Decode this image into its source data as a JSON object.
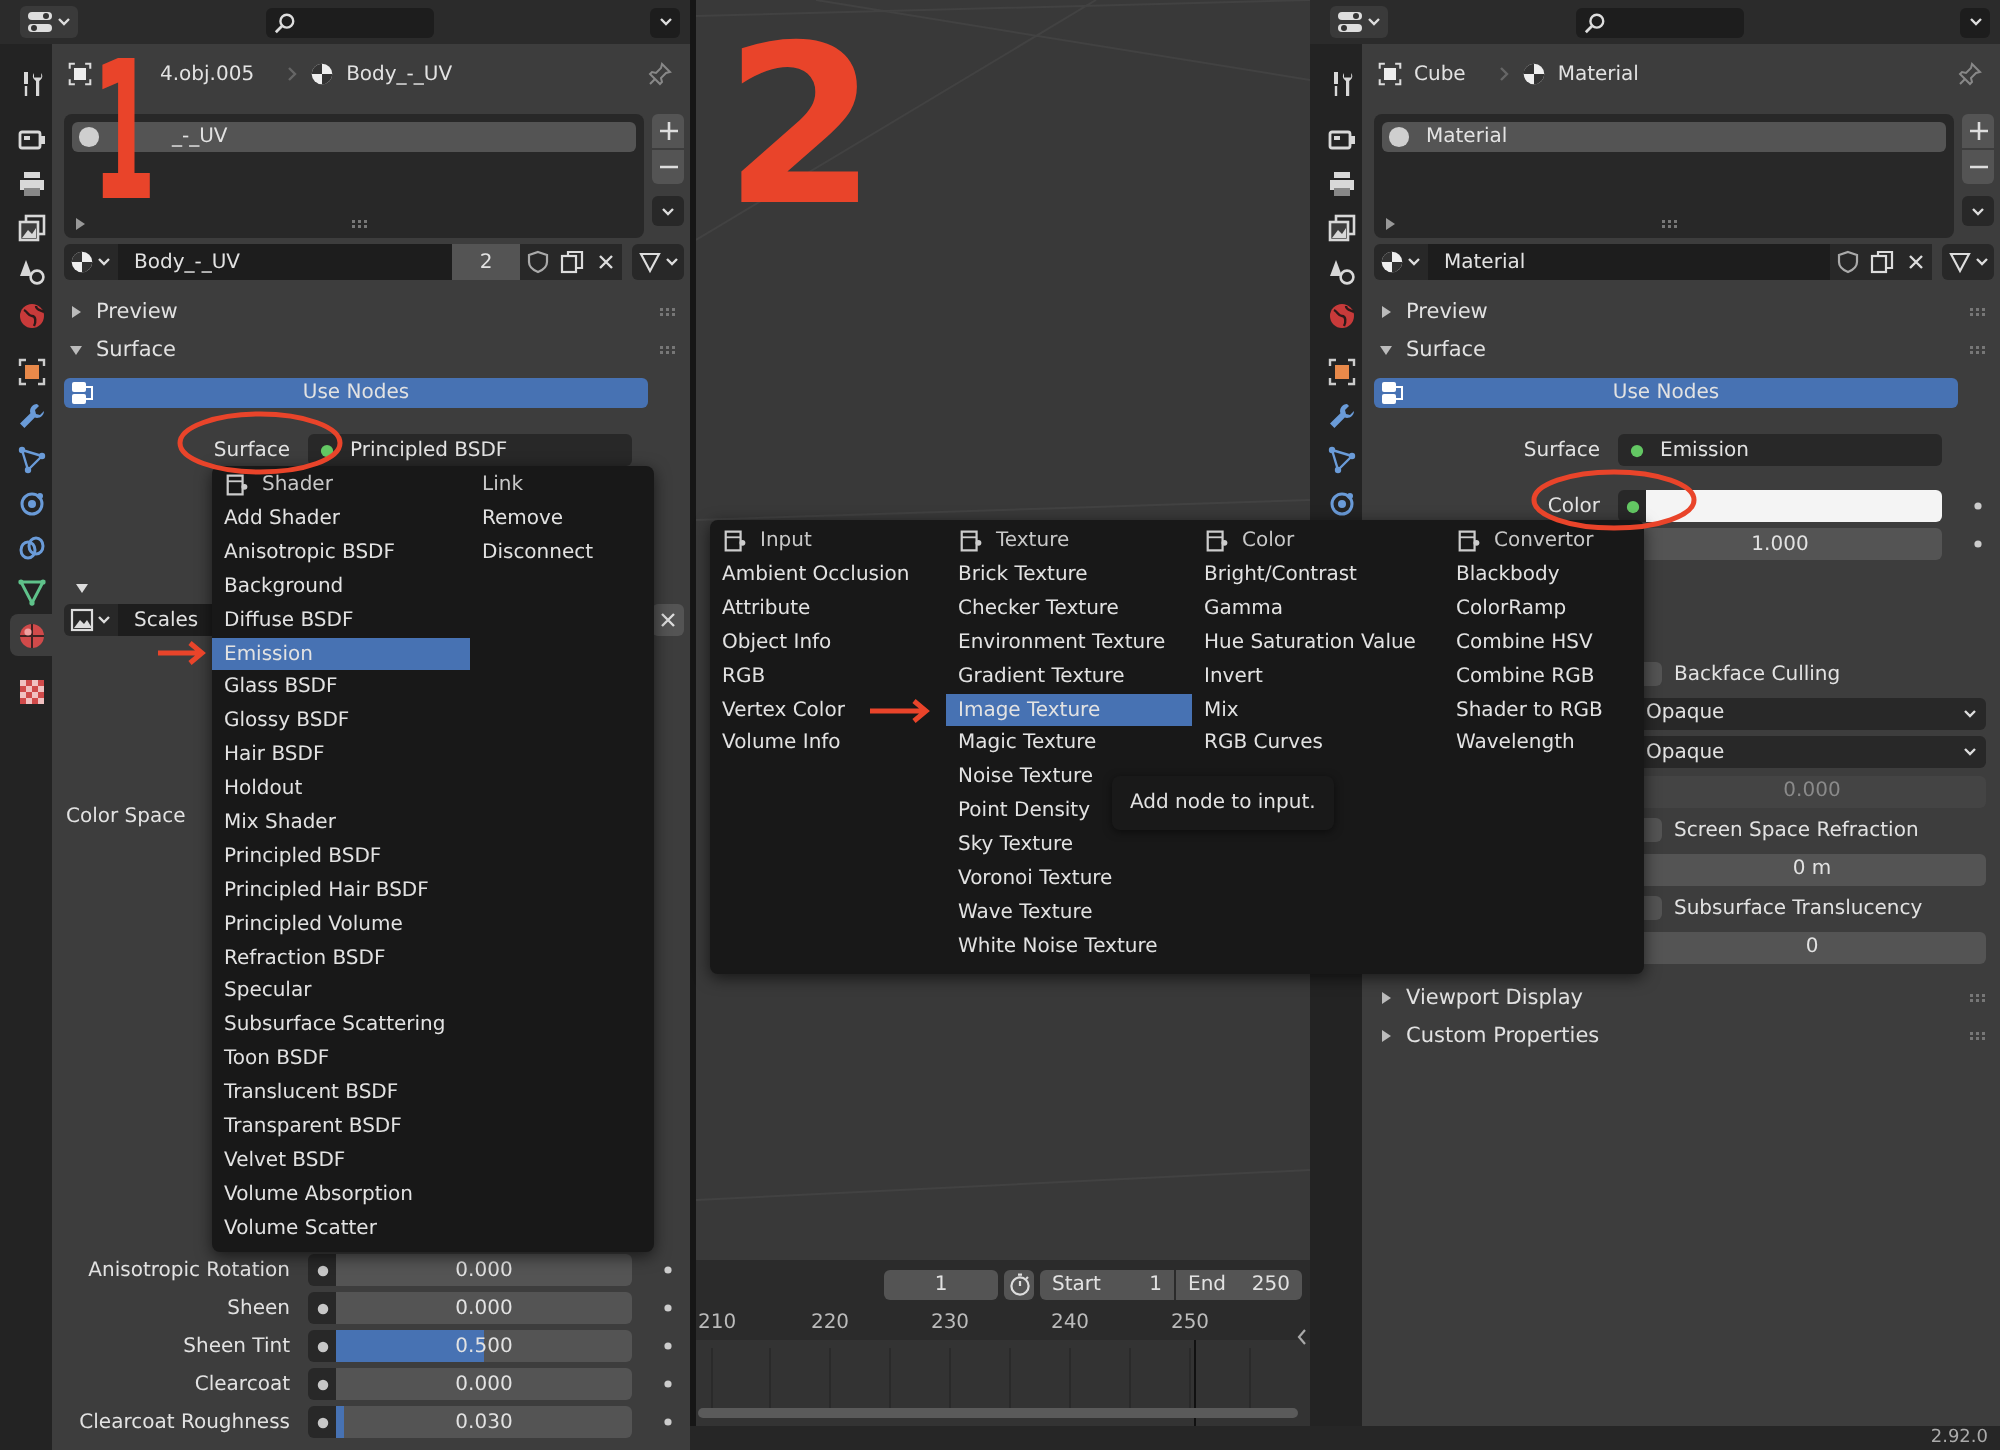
{
  "panels": [
    {
      "tabs": [
        {
          "kind": "tool",
          "selected": false
        },
        {
          "kind": "render",
          "selected": false
        },
        {
          "kind": "output",
          "selected": false
        },
        {
          "kind": "view_layer",
          "selected": false
        },
        {
          "kind": "scene",
          "selected": false
        },
        {
          "kind": "world",
          "selected": false
        },
        {
          "kind": "object",
          "selected": false
        },
        {
          "kind": "modifier",
          "selected": false
        },
        {
          "kind": "particles",
          "selected": false
        },
        {
          "kind": "physics",
          "selected": false
        },
        {
          "kind": "constraints",
          "selected": false
        },
        {
          "kind": "data",
          "selected": false
        },
        {
          "kind": "material",
          "selected": true
        },
        {
          "kind": "texture",
          "selected": false
        }
      ],
      "breadcrumb": [
        {
          "kind": "object",
          "text": "4.obj.005"
        },
        {
          "kind": "material",
          "text": "Body_-_UV"
        }
      ],
      "slots": [
        {
          "name": "_-_UV",
          "selected": true
        }
      ],
      "datablock": {
        "name": "Body_-_UV",
        "users": "2"
      },
      "sections": [
        {
          "label": "Preview",
          "expanded": false
        },
        {
          "label": "Surface",
          "expanded": true
        }
      ],
      "use_nodes": "Use Nodes",
      "surface": {
        "label": "Surface",
        "value": "Principled BSDF"
      },
      "image_texture": {
        "value": "Scales"
      },
      "color_space": {
        "label": "Color Space"
      },
      "properties": [
        {
          "label": "Anisotropic Rotation",
          "value": "0.000",
          "level": 0
        },
        {
          "label": "Sheen",
          "value": "0.000",
          "level": 0
        },
        {
          "label": "Sheen Tint",
          "value": "0.500",
          "level": 0.5
        },
        {
          "label": "Clearcoat",
          "value": "0.000",
          "level": 0
        },
        {
          "label": "Clearcoat Roughness",
          "value": "0.030",
          "level": 0.03
        }
      ]
    },
    {
      "tabs": [
        {
          "kind": "tool",
          "selected": false
        },
        {
          "kind": "render",
          "selected": false
        },
        {
          "kind": "output",
          "selected": false
        },
        {
          "kind": "view_layer",
          "selected": false
        },
        {
          "kind": "scene",
          "selected": false
        },
        {
          "kind": "world",
          "selected": false
        },
        {
          "kind": "object",
          "selected": false
        },
        {
          "kind": "modifier",
          "selected": false
        },
        {
          "kind": "particles",
          "selected": false
        },
        {
          "kind": "physics",
          "selected": false
        }
      ],
      "breadcrumb": [
        {
          "kind": "object",
          "text": "Cube"
        },
        {
          "kind": "material",
          "text": "Material"
        }
      ],
      "slots": [
        {
          "name": "Material",
          "selected": true
        }
      ],
      "datablock": {
        "name": "Material"
      },
      "sections": [
        {
          "label": "Preview",
          "expanded": false
        },
        {
          "label": "Surface",
          "expanded": true
        }
      ],
      "use_nodes": "Use Nodes",
      "surface": {
        "label": "Surface",
        "value": "Emission"
      },
      "color": {
        "label": "Color",
        "color": "#f4f4f4"
      },
      "strength": {
        "value": "1.000"
      },
      "settings": [
        {
          "kind": "checkbox",
          "label": "Backface Culling",
          "checked": false
        },
        {
          "kind": "dropdown",
          "value": "Opaque"
        },
        {
          "kind": "dropdown",
          "value": "Opaque"
        },
        {
          "kind": "number",
          "value": "0.000",
          "disabled": true
        },
        {
          "kind": "checkbox",
          "label": "Screen Space Refraction",
          "checked": false
        },
        {
          "kind": "number",
          "value": "0 m",
          "disabled": false
        },
        {
          "kind": "checkbox",
          "label": "Subsurface Translucency",
          "checked": false
        },
        {
          "kind": "number",
          "value": "0",
          "disabled": false
        }
      ],
      "footer_sections": [
        {
          "label": "Viewport Display",
          "expanded": false
        },
        {
          "label": "Custom Properties",
          "expanded": false
        }
      ]
    }
  ],
  "shader_menu": {
    "columns": [
      {
        "title": "Shader",
        "items": [
          {
            "label": "Add Shader",
            "selected": false
          },
          {
            "label": "Anisotropic BSDF",
            "selected": false
          },
          {
            "label": "Background",
            "selected": false
          },
          {
            "label": "Diffuse BSDF",
            "selected": false
          },
          {
            "label": "Emission",
            "selected": true
          },
          {
            "label": "Glass BSDF",
            "selected": false
          },
          {
            "label": "Glossy BSDF",
            "selected": false
          },
          {
            "label": "Hair BSDF",
            "selected": false
          },
          {
            "label": "Holdout",
            "selected": false
          },
          {
            "label": "Mix Shader",
            "selected": false
          },
          {
            "label": "Principled BSDF",
            "selected": false
          },
          {
            "label": "Principled Hair BSDF",
            "selected": false
          },
          {
            "label": "Principled Volume",
            "selected": false
          },
          {
            "label": "Refraction BSDF",
            "selected": false
          },
          {
            "label": "Specular",
            "selected": false
          },
          {
            "label": "Subsurface Scattering",
            "selected": false
          },
          {
            "label": "Toon BSDF",
            "selected": false
          },
          {
            "label": "Translucent BSDF",
            "selected": false
          },
          {
            "label": "Transparent BSDF",
            "selected": false
          },
          {
            "label": "Velvet BSDF",
            "selected": false
          },
          {
            "label": "Volume Absorption",
            "selected": false
          },
          {
            "label": "Volume Scatter",
            "selected": false
          }
        ]
      },
      {
        "title": "Link",
        "items": [
          {
            "label": "Remove",
            "selected": false
          },
          {
            "label": "Disconnect",
            "selected": false
          }
        ]
      }
    ]
  },
  "node_menu": {
    "columns": [
      {
        "title": "Input",
        "items": [
          {
            "label": "Ambient Occlusion",
            "selected": false
          },
          {
            "label": "Attribute",
            "selected": false
          },
          {
            "label": "Object Info",
            "selected": false
          },
          {
            "label": "RGB",
            "selected": false
          },
          {
            "label": "Vertex Color",
            "selected": false
          },
          {
            "label": "Volume Info",
            "selected": false
          }
        ]
      },
      {
        "title": "Texture",
        "items": [
          {
            "label": "Brick Texture",
            "selected": false
          },
          {
            "label": "Checker Texture",
            "selected": false
          },
          {
            "label": "Environment Texture",
            "selected": false
          },
          {
            "label": "Gradient Texture",
            "selected": false
          },
          {
            "label": "Image Texture",
            "selected": true
          },
          {
            "label": "Magic Texture",
            "selected": false
          },
          {
            "label": "Noise Texture",
            "selected": false
          },
          {
            "label": "Point Density",
            "selected": false
          },
          {
            "label": "Sky Texture",
            "selected": false
          },
          {
            "label": "Voronoi Texture",
            "selected": false
          },
          {
            "label": "Wave Texture",
            "selected": false
          },
          {
            "label": "White Noise Texture",
            "selected": false
          }
        ]
      },
      {
        "title": "Color",
        "items": [
          {
            "label": "Bright/Contrast",
            "selected": false
          },
          {
            "label": "Gamma",
            "selected": false
          },
          {
            "label": "Hue Saturation Value",
            "selected": false
          },
          {
            "label": "Invert",
            "selected": false
          },
          {
            "label": "Mix",
            "selected": false
          },
          {
            "label": "RGB Curves",
            "selected": false
          }
        ]
      },
      {
        "title": "Convertor",
        "items": [
          {
            "label": "Blackbody",
            "selected": false
          },
          {
            "label": "ColorRamp",
            "selected": false
          },
          {
            "label": "Combine HSV",
            "selected": false
          },
          {
            "label": "Combine RGB",
            "selected": false
          },
          {
            "label": "Shader to RGB",
            "selected": false
          },
          {
            "label": "Wavelength",
            "selected": false
          }
        ]
      }
    ],
    "tooltip": "Add node to input."
  },
  "timeline": {
    "current_frame": "1",
    "start_label": "Start",
    "start": "1",
    "end_label": "End",
    "end": "250",
    "ruler": [
      "210",
      "220",
      "230",
      "240",
      "250"
    ]
  },
  "status_bar": {
    "version": "2.92.0"
  },
  "annotations": {
    "numbers": [
      "1",
      "2"
    ]
  }
}
